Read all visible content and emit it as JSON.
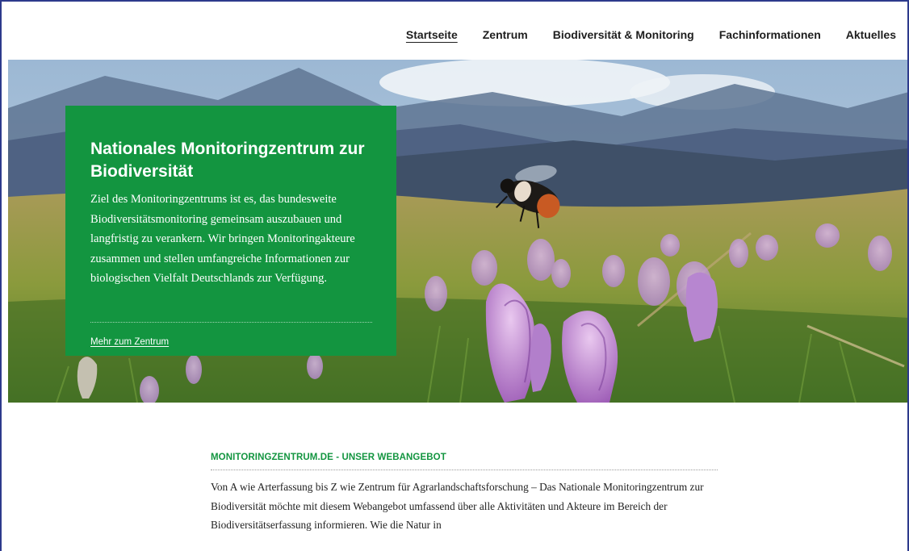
{
  "nav": {
    "items": [
      {
        "label": "Startseite",
        "active": true
      },
      {
        "label": "Zentrum",
        "active": false
      },
      {
        "label": "Biodiversität & Monitoring",
        "active": false
      },
      {
        "label": "Fachinformationen",
        "active": false
      },
      {
        "label": "Aktuelles",
        "active": false
      }
    ]
  },
  "hero": {
    "image": "bumblebee-over-crocus-meadow",
    "title": "Nationales Monitoringzentrum zur Biodiversität",
    "text": "Ziel des Monitoringzentrums ist es, das bundesweite Biodiversitätsmonitoring gemeinsam auszubauen und langfristig zu verankern. Wir bringen Monitoringakteure zusammen und stellen umfangreiche Informationen zur biologischen Vielfalt Deutschlands zur Verfügung.",
    "link_label": "Mehr zum Zentrum"
  },
  "section": {
    "heading": "MONITORINGZENTRUM.DE - UNSER WEBANGEBOT",
    "text": "Von A wie Arterfassung bis Z wie Zentrum für Agrarlandschaftsforschung – Das Nationale Monitoringzentrum zur Biodiversität möchte mit diesem Webangebot umfassend über alle Aktivitäten und Akteure im Bereich der Biodiversitätserfassung informieren. Wie die Natur in"
  },
  "colors": {
    "brand_green": "#139540",
    "text_dark": "#222222",
    "frame_border": "#2d3a8c"
  }
}
